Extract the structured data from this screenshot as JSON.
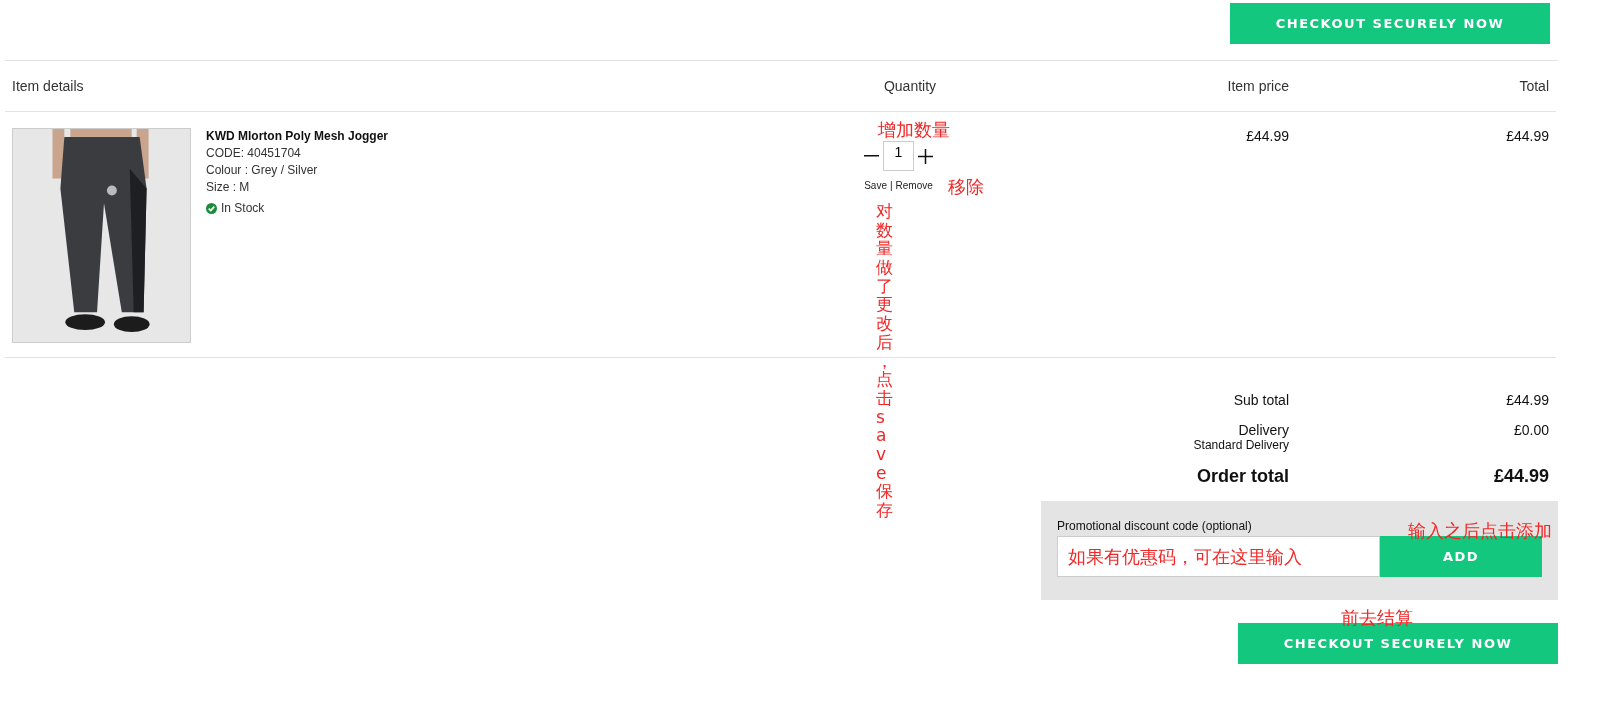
{
  "checkout_top": "CHECKOUT SECURELY NOW",
  "table": {
    "columns": [
      "Item details",
      "Quantity",
      "Item price",
      "Total"
    ],
    "rows": [
      {
        "name": "KWD Mlorton Poly Mesh Jogger",
        "code": "CODE: 40451704",
        "colour": "Colour : Grey / Silver",
        "size": "Size : M",
        "stock": "In Stock",
        "in_stock": true,
        "quantity": "1",
        "save": "Save",
        "separator": "|",
        "remove": "Remove",
        "price": "£44.99",
        "total": "£44.99",
        "quantity_annotation": "增加数量",
        "remove_annotation": "移除",
        "save_annotation": "对数量做了更改后，点击save保存"
      }
    ]
  },
  "summary": [
    {
      "kind": "line",
      "label": "Sub total",
      "value": "£44.99"
    },
    {
      "kind": "line",
      "label": "Delivery",
      "sublabel": "Standard Delivery",
      "value": "£0.00"
    },
    {
      "kind": "total",
      "label": "Order total",
      "value": "£44.99"
    }
  ],
  "promo": {
    "label": "Promotional discount code (optional)",
    "field_annotation": "如果有优惠码，可在这里输入",
    "button": "ADD",
    "button_annotation": "输入之后点击添加"
  },
  "checkout_bottom_annotation": "前去结算",
  "checkout_bottom": "CHECKOUT SECURELY NOW"
}
